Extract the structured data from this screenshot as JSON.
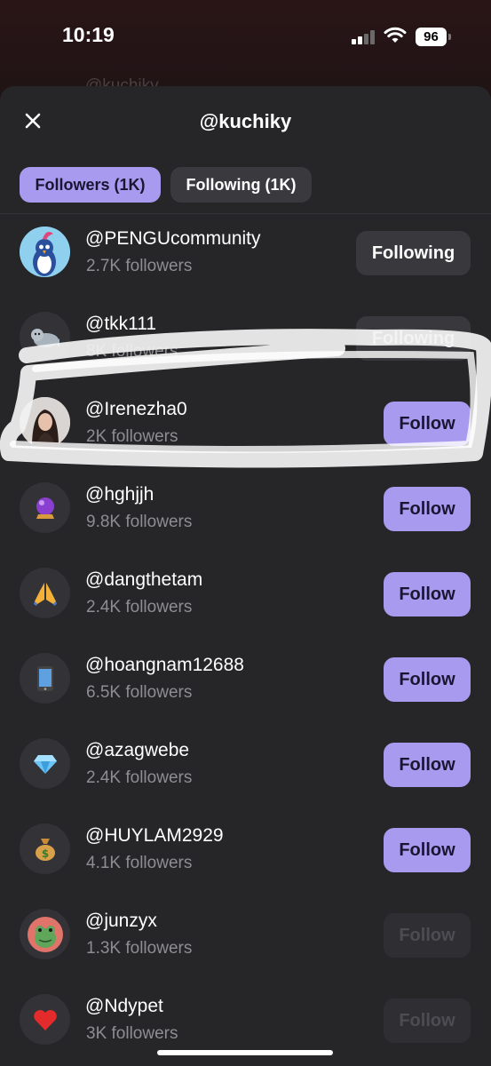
{
  "status_bar": {
    "time": "10:19",
    "battery": "96"
  },
  "background": {
    "header_text": "@kuchiky"
  },
  "sheet": {
    "title": "@kuchiky",
    "tabs": [
      {
        "label": "Followers (1K)",
        "active": true
      },
      {
        "label": "Following (1K)",
        "active": false
      }
    ]
  },
  "users": [
    {
      "handle": "@PENGUcommunity",
      "followers": "2.7K followers",
      "button": "Following",
      "avatar_icon": "penguin-icon"
    },
    {
      "handle": "@tkk111",
      "followers": "8K followers",
      "button": "Following",
      "avatar_icon": "seal-icon"
    },
    {
      "handle": "@Irenezha0",
      "followers": "2K followers",
      "button": "Follow",
      "avatar_icon": "photo-avatar"
    },
    {
      "handle": "@hghjjh",
      "followers": "9.8K followers",
      "button": "Follow",
      "avatar_icon": "crystal-ball-icon"
    },
    {
      "handle": "@dangthetam",
      "followers": "2.4K followers",
      "button": "Follow",
      "avatar_icon": "praying-hands-icon"
    },
    {
      "handle": "@hoangnam12688",
      "followers": "6.5K followers",
      "button": "Follow",
      "avatar_icon": "mobile-phone-icon"
    },
    {
      "handle": "@azagwebe",
      "followers": "2.4K followers",
      "button": "Follow",
      "avatar_icon": "gem-icon"
    },
    {
      "handle": "@HUYLAM2929",
      "followers": "4.1K followers",
      "button": "Follow",
      "avatar_icon": "money-bag-icon"
    },
    {
      "handle": "@junzyx",
      "followers": "1.3K followers",
      "button": "Follow",
      "avatar_icon": "frog-icon"
    },
    {
      "handle": "@Ndypet",
      "followers": "3K followers",
      "button": "Follow",
      "avatar_icon": "red-heart-icon"
    }
  ],
  "colors": {
    "accent": "#a89bef",
    "sheet_bg": "#262528",
    "secondary_button": "#39383d"
  }
}
